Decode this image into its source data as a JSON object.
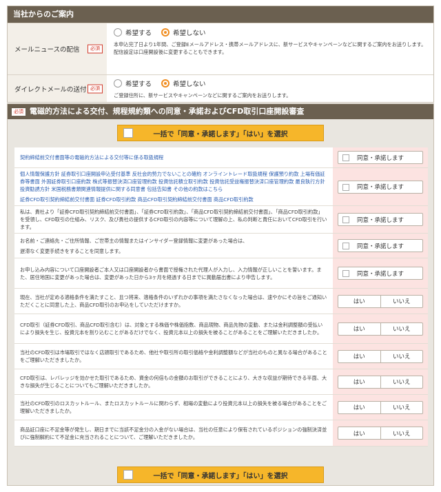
{
  "notice": {
    "title": "当社からのご案内",
    "required_label": "必須",
    "mail_news": {
      "label": "メールニュースの配信",
      "option_yes": "希望する",
      "option_no": "希望しない",
      "selected": "希望しない",
      "note": "本申込完了日より1年間、ご登録Eメールアドレス・携帯メールアドレスに、新サービスやキャンペーンなどに関するご案内をお送りします。配信設定は口座開設後に変更することもできます。"
    },
    "direct_mail": {
      "label": "ダイレクトメールの送付",
      "option_yes": "希望する",
      "option_no": "希望しない",
      "selected": "希望しない",
      "note": "ご登録住所に、新サービスやキャンペーンなどに関するご案内をお送りします。"
    }
  },
  "consent": {
    "required_label": "必須",
    "title": "電磁的方法による交付、規程規約類への同意・承諾およびCFD取引口座開設審査",
    "bulk_button": "一括で「同意・承諾します」「はい」を選択",
    "agree_label": "同意・承諾します",
    "yes_label": "はい",
    "no_label": "いいえ",
    "items": [
      {
        "lines": [
          "契約締結前交付書面等の電磁的方法による交付等に係る取扱規程"
        ],
        "link": true,
        "action": "agree"
      },
      {
        "lines": [
          "個人情報保護方針 証券取引口座開設申込受付基準 反社会的勢力でないことの確約 オンライントレード取扱規程 保護預り約款 上場有価証券等書面 外国証券取引口座約款 株式等振替決済口座管理約款 投資信託積立取引約款 投資信託受益権振替決済口座管理約款 最良執行方針 投資勧誘方針 米国税務書類関連情報提供に関する同意書 包括告知書 その他の約款はこちら",
          "証券CFD取引契約締結前交付書面 証券CFD取引約款 商品CFD取引契約締結前交付書面 商品CFD取引約款"
        ],
        "link": true,
        "action": "agree"
      },
      {
        "lines": [
          "私は、貴社より「証券CFD取引契約締結前交付書面」、「証券CFD取引約款」、「商品CFD取引契約締結前交付書面」、「商品CFD取引約款」を受領し、CFD取引の仕組み、リスク、及び貴社の提供するCFD取引の内容等について理解の上、私の判断と責任においてCFD取引を行います。"
        ],
        "link": false,
        "action": "agree"
      },
      {
        "lines": [
          "お名前・ご連絡先・ご住所情報、ご世帯主の情報またはインサイダー登録情報に変更があった場合は、",
          "遅滞なく変更手続きをすることを同意します。"
        ],
        "link": false,
        "action": "agree"
      },
      {
        "lines": [
          "お申し込み内容について口座開設者ご本人又は口座開設者から書面で授権された代理人が入力し、入力情報が正しいことを誓います。また、居住地国に変更があった場合は、変更があった日から3ヶ月を経過する日までに異動届出書により申告します。"
        ],
        "link": false,
        "action": "agree"
      },
      {
        "lines": [
          "現在、当社が定める適格条件を満たすこと、且つ将来、適格条件のいずれかの事項を満たさなくなった場合は、速やかにその旨をご通知いただくことに同意した上、商品CFD取引のお申込をしていただけますか。"
        ],
        "link": false,
        "action": "yesno"
      },
      {
        "lines": [
          "CFD取引（証券CFD取引、商品CFD取引含む）は、対象とする株価や株価指数、商品現物、商品先物の変動、または金利調整額の受払いにより損失を生じ、投資元本を割り込むことがあるだけでなく、投資元本以上の損失を被ることがあることをご理解いただきましたか。"
        ],
        "link": false,
        "action": "yesno"
      },
      {
        "lines": [
          "当社のCFD取引は市場取引ではなく店頭取引であるため、他社や取引所の取引価格や金利調整額などが当社のものと異なる場合があることをご理解いただきましたか。"
        ],
        "link": false,
        "action": "yesno"
      },
      {
        "lines": [
          "CFD取引は、レバレッジを効かせた取引であるため、資金の何倍もの金額のお取引ができることにより、大きな収益が期待できる半面、大きな損失が生じることについてもご理解いただきましたか。"
        ],
        "link": false,
        "action": "yesno"
      },
      {
        "lines": [
          "当社のCFD取引のロスカットルール、またロスカットルールに関わらず、相場の変動により投資元本以上の損失を被る場合があることをご理解いただきましたか。"
        ],
        "link": false,
        "action": "yesno"
      },
      {
        "lines": [
          "商品証口座に不足金等が発生し、期日までに当該不足金分の入金がない場合は、当社の任意により保有されているポジションの強制決済並びに強制解約にて不足金に充当されることについて、ご理解いただきましたか。"
        ],
        "link": false,
        "action": "yesno"
      }
    ]
  }
}
